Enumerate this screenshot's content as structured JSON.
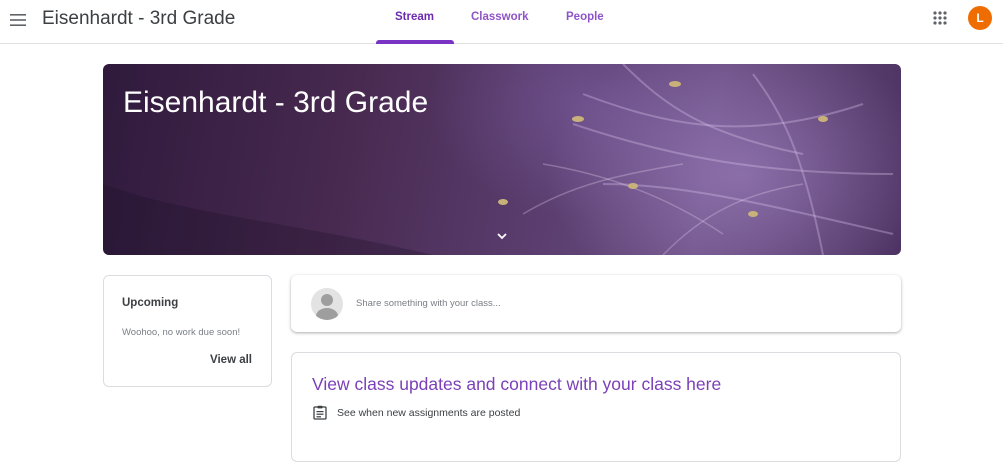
{
  "header": {
    "title": "Eisenhardt - 3rd Grade",
    "menu_icon": "hamburger-menu-icon",
    "apps_icon": "google-apps-grid-icon",
    "avatar_letter": "L",
    "avatar_color": "#ef6c00"
  },
  "tabs": [
    {
      "label": "Stream",
      "active": true
    },
    {
      "label": "Classwork",
      "active": false
    },
    {
      "label": "People",
      "active": false
    }
  ],
  "banner": {
    "title": "Eisenhardt - 3rd Grade",
    "expand_icon": "chevron-down-icon"
  },
  "upcoming": {
    "title": "Upcoming",
    "message": "Woohoo, no work due soon!",
    "view_all": "View all"
  },
  "share": {
    "placeholder": "Share something with your class..."
  },
  "updates": {
    "title": "View class updates and connect with your class here",
    "item_icon": "assignment-icon",
    "item_text": "See when new assignments are posted"
  },
  "colors": {
    "accent": "#7a34c3",
    "tab_text": "#8f55c8"
  }
}
